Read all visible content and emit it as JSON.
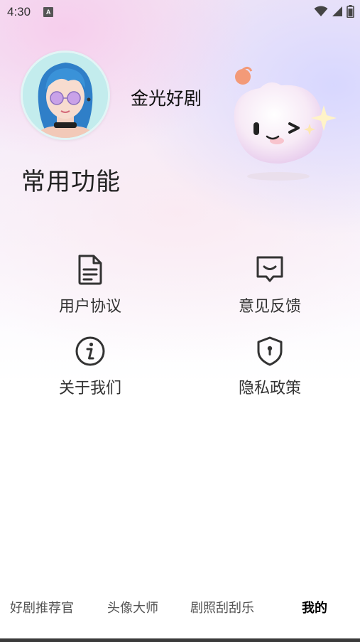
{
  "status_bar": {
    "time": "4:30",
    "notification_glyph": "A",
    "icons": [
      "wifi-icon",
      "signal-icon",
      "battery-icon"
    ]
  },
  "profile": {
    "app_name": "金光好剧",
    "avatar": "avatar-girl-illustration"
  },
  "section": {
    "title": "常用功能"
  },
  "features": [
    {
      "label": "用户协议",
      "icon": "document-icon"
    },
    {
      "label": "意见反馈",
      "icon": "feedback-icon"
    },
    {
      "label": "关于我们",
      "icon": "info-icon"
    },
    {
      "label": "隐私政策",
      "icon": "shield-icon"
    }
  ],
  "tabs": [
    {
      "label": "好剧推荐官",
      "active": false
    },
    {
      "label": "头像大师",
      "active": false
    },
    {
      "label": "剧照刮刮乐",
      "active": false
    },
    {
      "label": "我的",
      "active": true
    }
  ],
  "colors": {
    "icon_stroke": "#333333",
    "tab_active": "#000000",
    "tab_inactive": "#555555"
  }
}
